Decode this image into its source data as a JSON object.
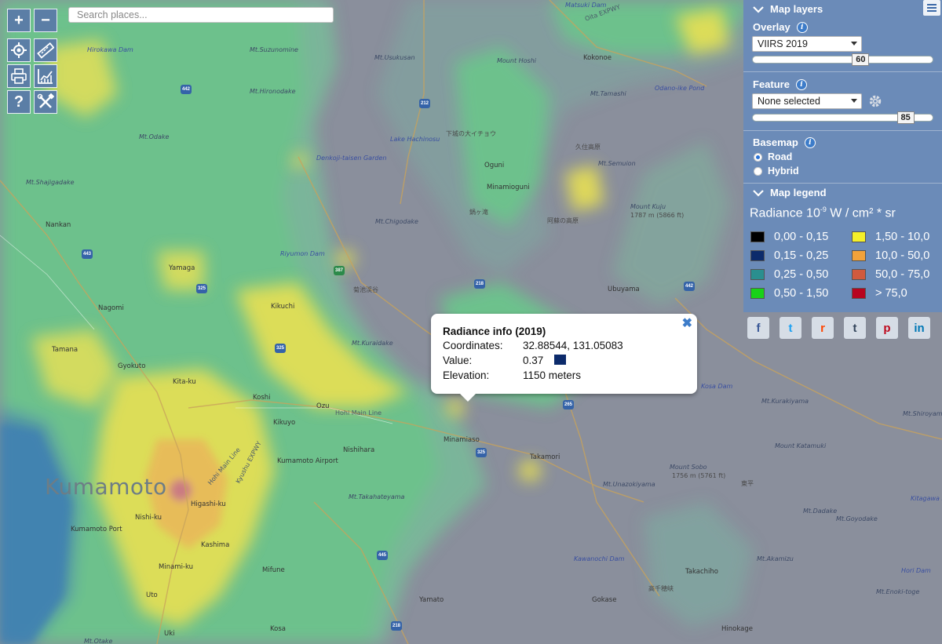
{
  "map": {
    "city_label": "Kumamoto",
    "places": [
      "Kikuchi",
      "Nagomi",
      "Yamaga",
      "Tamana",
      "Gyokuto",
      "Nankan",
      "Kita-ku",
      "Koshi",
      "Ozu",
      "Kikuyo",
      "Nishihara",
      "Higashi-ku",
      "Nishi-ku",
      "Minami-ku",
      "Mifune",
      "Kashima",
      "Kosa",
      "Uto",
      "Uki",
      "Yamato",
      "Minamiaso",
      "Takamori",
      "Ubuyama",
      "Minamioguni",
      "Oguni",
      "Kokonoe",
      "Gokase",
      "Takachiho",
      "Hinokage",
      "Kumamoto Airport",
      "Kumamoto Port"
    ],
    "peaks": [
      "Mt.Suzunomine",
      "Mt.Hironodake",
      "Mt.Odake",
      "Mt.Shajigadake",
      "Mt.Chigodake",
      "Mt.Kuraidake",
      "Mt.Takahateyama",
      "Mt.Unazokiyama",
      "Mt.Akamizu",
      "Mt.Kurakiyama",
      "Mt.Shiroyama",
      "Mount Katamuki",
      "Mt.Dadake",
      "Mt.Goyodake",
      "Mt.Enoki-toge",
      "Mount Kuju",
      "Mount Sobo",
      "Mt.Usukusan",
      "Mount Hoshi",
      "Mt.Semuion",
      "Mt.Otake",
      "Mt.Tamashi"
    ],
    "waters": [
      "Hirokawa Dam",
      "Lake Hachinosu",
      "Denkoji-taisen Garden",
      "Riyumon Dam",
      "Odano-ike Pond",
      "Kawanochi Dam",
      "Hori Dam",
      "Kitagawa Dam",
      "Matsuki Dam",
      "Kosa Dam"
    ],
    "roads": [
      "Kyushu EXPWY",
      "Oita EXPWY",
      "Hohi Main Line",
      "Hohi Main Line"
    ],
    "route_numbers": [
      "442",
      "212",
      "387",
      "325",
      "443",
      "265",
      "325",
      "445",
      "218",
      "218",
      "442",
      "325"
    ],
    "elevation_notes": [
      "1787 m (5866 ft)",
      "1756 m (5761 ft)"
    ],
    "jp_labels": [
      "菊池渓谷",
      "下城の大イチョウ",
      "鍋ヶ滝",
      "阿蘇の高原",
      "久住高原",
      "東平",
      "高千穂峡"
    ]
  },
  "search": {
    "placeholder": "Search places..."
  },
  "toolbar": {
    "zoom_in": "+",
    "zoom_out": "−",
    "help": "?"
  },
  "panel": {
    "layers_title": "Map layers",
    "overlay_label": "Overlay",
    "overlay_value": "VIIRS 2019",
    "overlay_opacity": "60",
    "overlay_opacity_pct": 60,
    "feature_label": "Feature",
    "feature_value": "None selected",
    "feature_opacity": "85",
    "feature_opacity_pct": 85,
    "basemap_label": "Basemap",
    "basemap_options": [
      "Road",
      "Hybrid"
    ],
    "basemap_selected": "Road",
    "legend_title": "Map legend",
    "legend_heading_pre": "Radiance 10",
    "legend_heading_exp": "-9",
    "legend_heading_post": " W / cm² * sr",
    "legend": [
      {
        "range": "0,00 - 0,15",
        "color": "#000000"
      },
      {
        "range": "0,15 - 0,25",
        "color": "#0c2b6b"
      },
      {
        "range": "0,25 - 0,50",
        "color": "#2a8f8f"
      },
      {
        "range": "0,50 - 1,50",
        "color": "#19d219"
      },
      {
        "range": "1,50 - 10,0",
        "color": "#f4f02a"
      },
      {
        "range": "10,0 - 50,0",
        "color": "#f2a23a"
      },
      {
        "range": "50,0 - 75,0",
        "color": "#d05a3e"
      },
      {
        "range": "> 75,0",
        "color": "#b7041f"
      }
    ]
  },
  "popup": {
    "title": "Radiance info (2019)",
    "coordinates_label": "Coordinates:",
    "coordinates_value": "32.88544, 131.05083",
    "value_label": "Value:",
    "value_value": "0.37",
    "value_color": "#0c2b6b",
    "elevation_label": "Elevation:",
    "elevation_value": "1150 meters"
  },
  "social": [
    {
      "name": "facebook",
      "glyph": "f",
      "color": "#3b5998"
    },
    {
      "name": "twitter",
      "glyph": "t",
      "color": "#1da1f2"
    },
    {
      "name": "reddit",
      "glyph": "r",
      "color": "#ff4500"
    },
    {
      "name": "tumblr",
      "glyph": "t",
      "color": "#35465c"
    },
    {
      "name": "pinterest",
      "glyph": "p",
      "color": "#bd081c"
    },
    {
      "name": "linkedin",
      "glyph": "in",
      "color": "#0077b5"
    }
  ]
}
